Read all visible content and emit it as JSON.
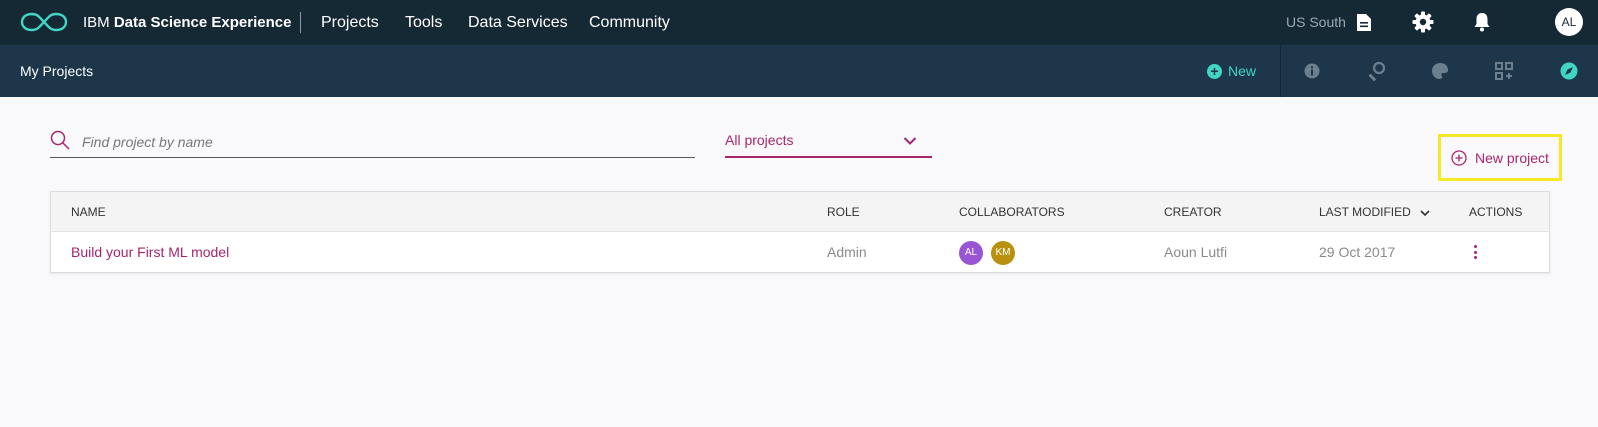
{
  "topbar": {
    "brand_prefix": "IBM",
    "brand_name": "Data Science Experience",
    "nav": [
      "Projects",
      "Tools",
      "Data Services",
      "Community"
    ],
    "region": "US South",
    "user_initials": "AL",
    "icons": [
      "document-icon",
      "gear-icon",
      "bell-icon"
    ]
  },
  "subbar": {
    "title": "My Projects",
    "new_label": "New",
    "icons": [
      "info-icon",
      "find-data-icon",
      "palette-icon",
      "grid-icon",
      "compass-icon"
    ]
  },
  "search": {
    "placeholder": "Find project by name",
    "value": ""
  },
  "filter": {
    "selected": "All projects"
  },
  "new_project_label": "New project",
  "table": {
    "columns": [
      "NAME",
      "ROLE",
      "COLLABORATORS",
      "CREATOR",
      "LAST MODIFIED",
      "ACTIONS"
    ],
    "rows": [
      {
        "name": "Build your First ML model",
        "role": "Admin",
        "collaborators": [
          {
            "initials": "AL",
            "color": "#9855d4"
          },
          {
            "initials": "KM",
            "color": "#b8920e"
          }
        ],
        "creator": "Aoun Lutfi",
        "last_modified": "29 Oct 2017"
      }
    ]
  },
  "colors": {
    "topbar": "#152935",
    "subbar": "#1d3649",
    "accent": "#a6266e",
    "teal": "#41d6c3",
    "highlight": "#f7e925"
  }
}
